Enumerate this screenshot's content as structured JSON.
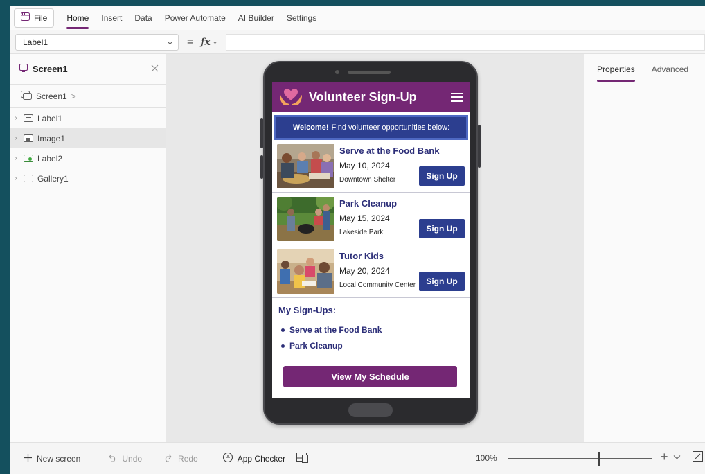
{
  "ribbon": {
    "file_label": "File",
    "tabs": [
      {
        "label": "Home",
        "active": true
      },
      {
        "label": "Insert"
      },
      {
        "label": "Data"
      },
      {
        "label": "Power Automate"
      },
      {
        "label": "AI Builder"
      },
      {
        "label": "Settings"
      }
    ]
  },
  "formula_bar": {
    "property": "Label1",
    "equals": "=",
    "fx": "fx",
    "formula": ""
  },
  "tree": {
    "title": "Screen1",
    "breadcrumb": "Screen1",
    "breadcrumb_sep": ">",
    "items": [
      {
        "label": "Label1",
        "icon": "label-icon"
      },
      {
        "label": "Image1",
        "icon": "image-icon",
        "selected": true
      },
      {
        "label": "Label2",
        "icon": "label2-icon"
      },
      {
        "label": "Gallery1",
        "icon": "gallery-icon"
      }
    ]
  },
  "app": {
    "title": "Volunteer Sign-Up",
    "welcome_bold": "Welcome!",
    "welcome_text": "Find volunteer opportunities below:",
    "opportunities": [
      {
        "title": "Serve at the Food Bank",
        "date": "May 10, 2024",
        "location": "Downtown Shelter",
        "button": "Sign Up"
      },
      {
        "title": "Park Cleanup",
        "date": "May 15, 2024",
        "location": "Lakeside Park",
        "button": "Sign Up"
      },
      {
        "title": "Tutor Kids",
        "date": "May 20, 2024",
        "location": "Local Community Center",
        "button": "Sign Up"
      }
    ],
    "my_signups_title": "My Sign-Ups:",
    "my_signups": [
      "Serve at the Food Bank",
      "Park Cleanup"
    ],
    "schedule_button": "View My Schedule",
    "colors": {
      "header": "#742774",
      "accent": "#2c3e8f",
      "text_accent": "#2c2e78"
    }
  },
  "properties_panel": {
    "tabs": [
      {
        "label": "Properties",
        "active": true
      },
      {
        "label": "Advanced"
      }
    ]
  },
  "bottom_bar": {
    "new_screen": "New screen",
    "undo": "Undo",
    "redo": "Redo",
    "app_checker": "App Checker",
    "zoom_minus": "—",
    "zoom": "100%",
    "zoom_plus": "+"
  }
}
